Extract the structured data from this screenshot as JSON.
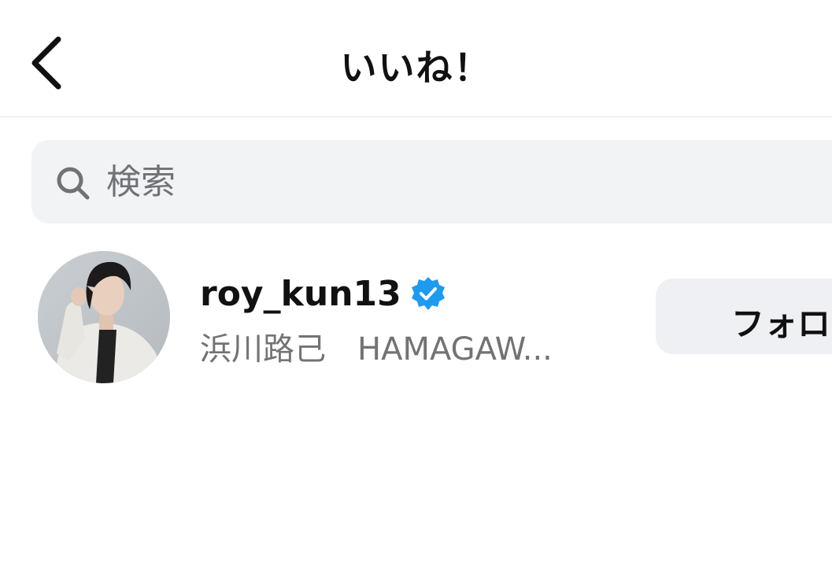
{
  "header": {
    "title": "いいね！",
    "back_icon": "chevron-left-icon"
  },
  "search": {
    "placeholder": "検索",
    "value": "",
    "icon": "search-icon"
  },
  "users": [
    {
      "username": "roy_kun13",
      "verified": true,
      "full_name": "浜川路己　HAMAGAW...",
      "follow_label": "フォロー"
    }
  ],
  "colors": {
    "text": "#111111",
    "secondary_text": "#737373",
    "search_bg": "#f2f3f5",
    "button_bg": "#eff0f3",
    "verified_blue": "#1d9bf0"
  }
}
